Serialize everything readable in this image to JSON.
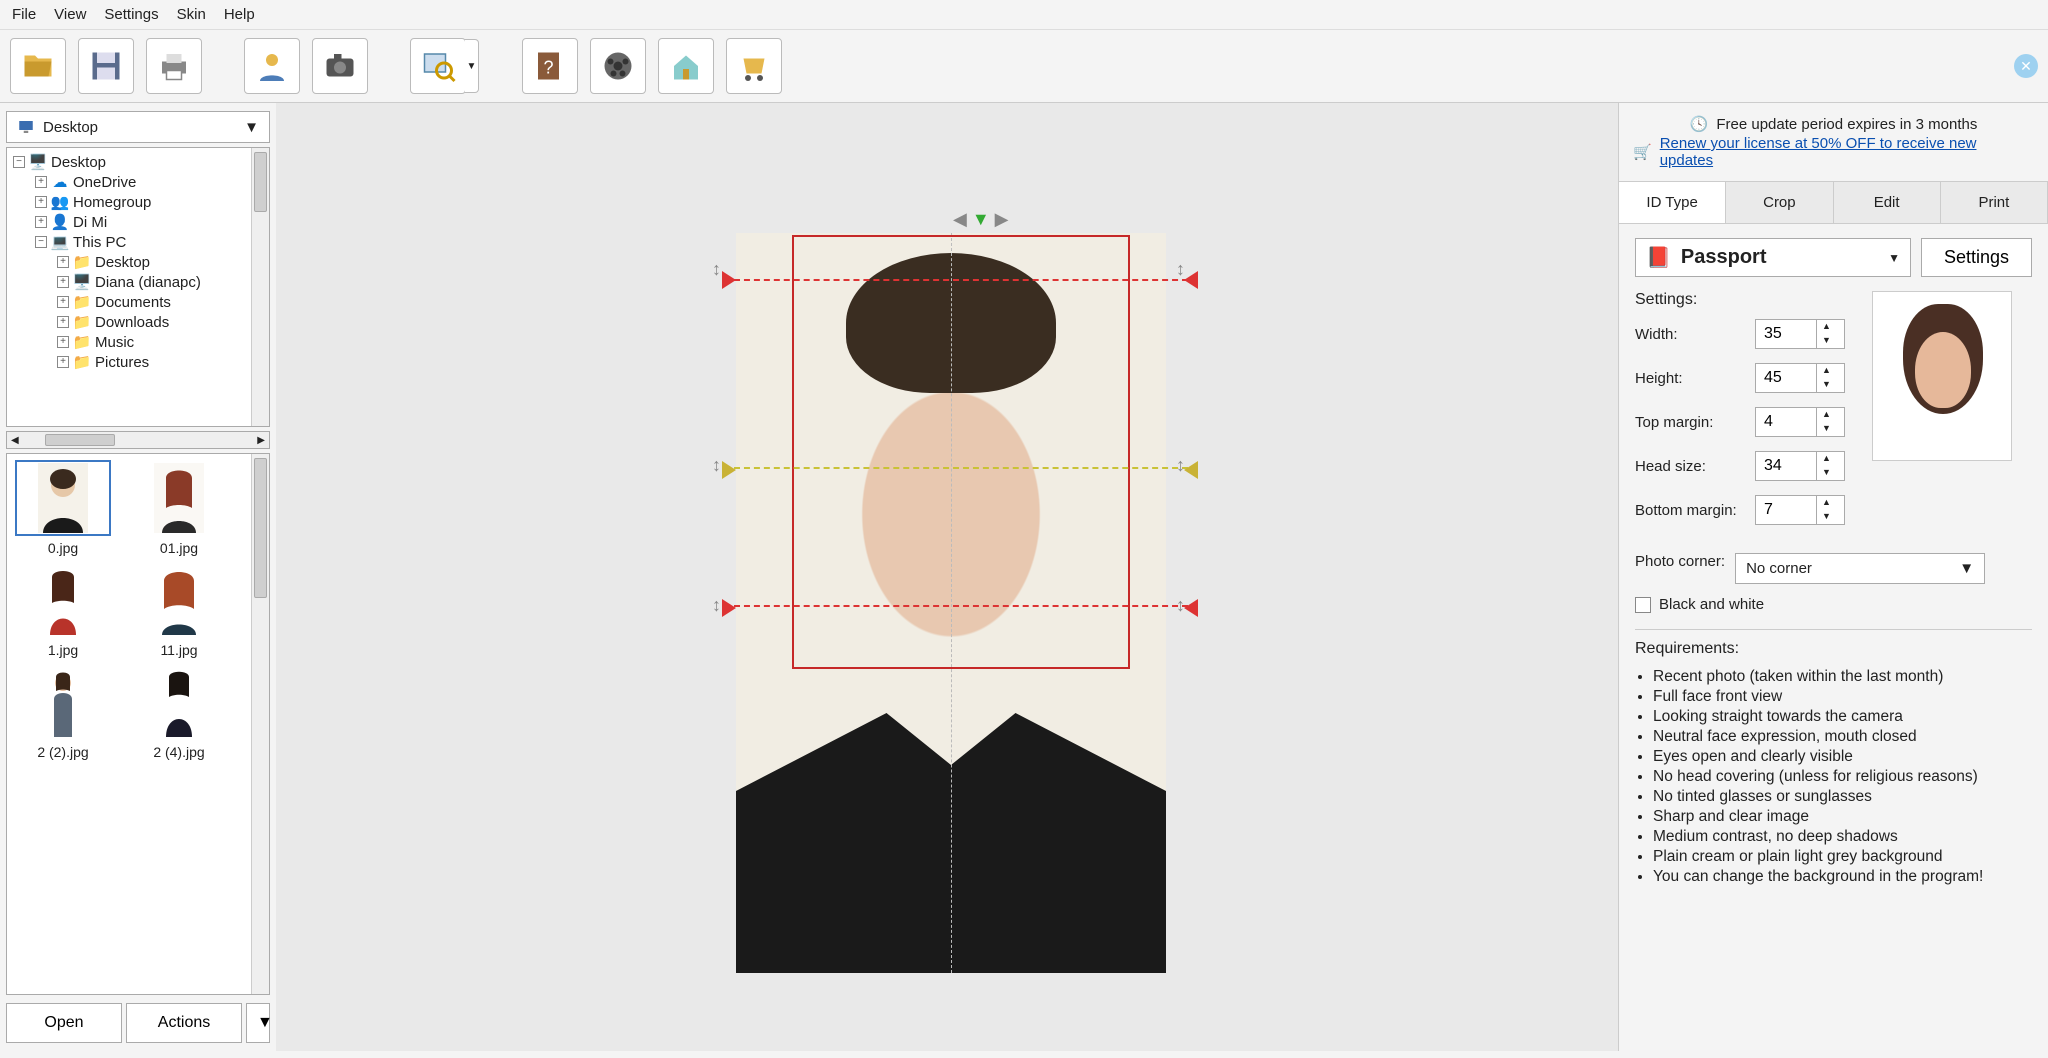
{
  "menu": {
    "file": "File",
    "view": "View",
    "settings": "Settings",
    "skin": "Skin",
    "help": "Help"
  },
  "promo": {
    "line1": "Free update period expires in 3 months",
    "line2": "Renew your license at 50% OFF to receive new updates"
  },
  "tabs": {
    "id": "ID Type",
    "crop": "Crop",
    "edit": "Edit",
    "print": "Print"
  },
  "location": "Desktop",
  "tree": {
    "root": "Desktop",
    "items": [
      "OneDrive",
      "Homegroup",
      "Di Mi",
      "This PC"
    ],
    "pc": [
      "Desktop",
      "Diana (dianapc)",
      "Documents",
      "Downloads",
      "Music",
      "Pictures"
    ]
  },
  "thumbs": [
    "0.jpg",
    "01.jpg",
    "1.jpg",
    "11.jpg",
    "2 (2).jpg",
    "2 (4).jpg"
  ],
  "buttons": {
    "open": "Open",
    "actions": "Actions",
    "settings": "Settings"
  },
  "idtype": "Passport",
  "settings_h": "Settings:",
  "fields": {
    "width_l": "Width:",
    "width_v": "35",
    "height_l": "Height:",
    "height_v": "45",
    "top_l": "Top margin:",
    "top_v": "4",
    "head_l": "Head size:",
    "head_v": "34",
    "bottom_l": "Bottom margin:",
    "bottom_v": "7",
    "corner_l": "Photo corner:",
    "corner_v": "No corner",
    "bw": "Black and white"
  },
  "req_h": "Requirements:",
  "reqs": [
    "Recent photo (taken within the last month)",
    "Full face front view",
    "Looking straight towards the camera",
    "Neutral face expression, mouth closed",
    "Eyes open and clearly visible",
    "No head covering (unless for religious reasons)",
    "No tinted glasses or sunglasses",
    "Sharp and clear image",
    "Medium contrast, no deep shadows",
    "Plain cream or plain light grey background",
    "You can change the background in the program!"
  ],
  "chart_data": null
}
